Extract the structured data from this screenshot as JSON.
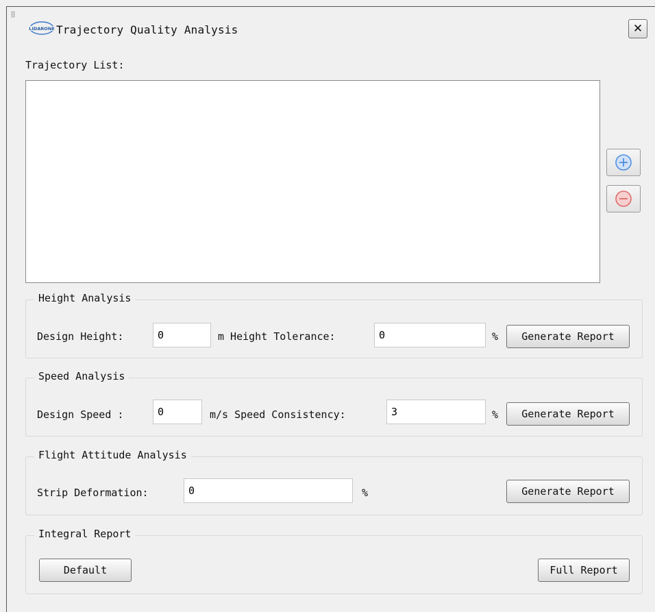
{
  "window": {
    "title": "Trajectory Quality Analysis",
    "logo_text": "LIDARONE"
  },
  "trajectory_list": {
    "label": "Trajectory List:",
    "items": []
  },
  "height_analysis": {
    "title": "Height Analysis",
    "design_height_label": "Design Height:",
    "design_height_value": "0",
    "tolerance_label": "m Height Tolerance:",
    "tolerance_value": "0",
    "percent": "%",
    "button": "Generate Report"
  },
  "speed_analysis": {
    "title": "Speed Analysis",
    "design_speed_label": "Design Speed :",
    "design_speed_value": "0",
    "consistency_label": "m/s Speed Consistency:",
    "consistency_value": "3",
    "percent": "%",
    "button": "Generate Report"
  },
  "attitude_analysis": {
    "title": "Flight Attitude Analysis",
    "strip_label": "Strip Deformation:",
    "strip_value": "0",
    "percent": "%",
    "button": "Generate Report"
  },
  "integral_report": {
    "title": "Integral Report",
    "default_button": "Default",
    "full_button": "Full Report"
  },
  "icons": {
    "add": "plus-circle-icon",
    "remove": "minus-circle-icon",
    "close": "close-icon"
  },
  "colors": {
    "add_blue": "#4f8fe0",
    "remove_red": "#e06a6a"
  }
}
